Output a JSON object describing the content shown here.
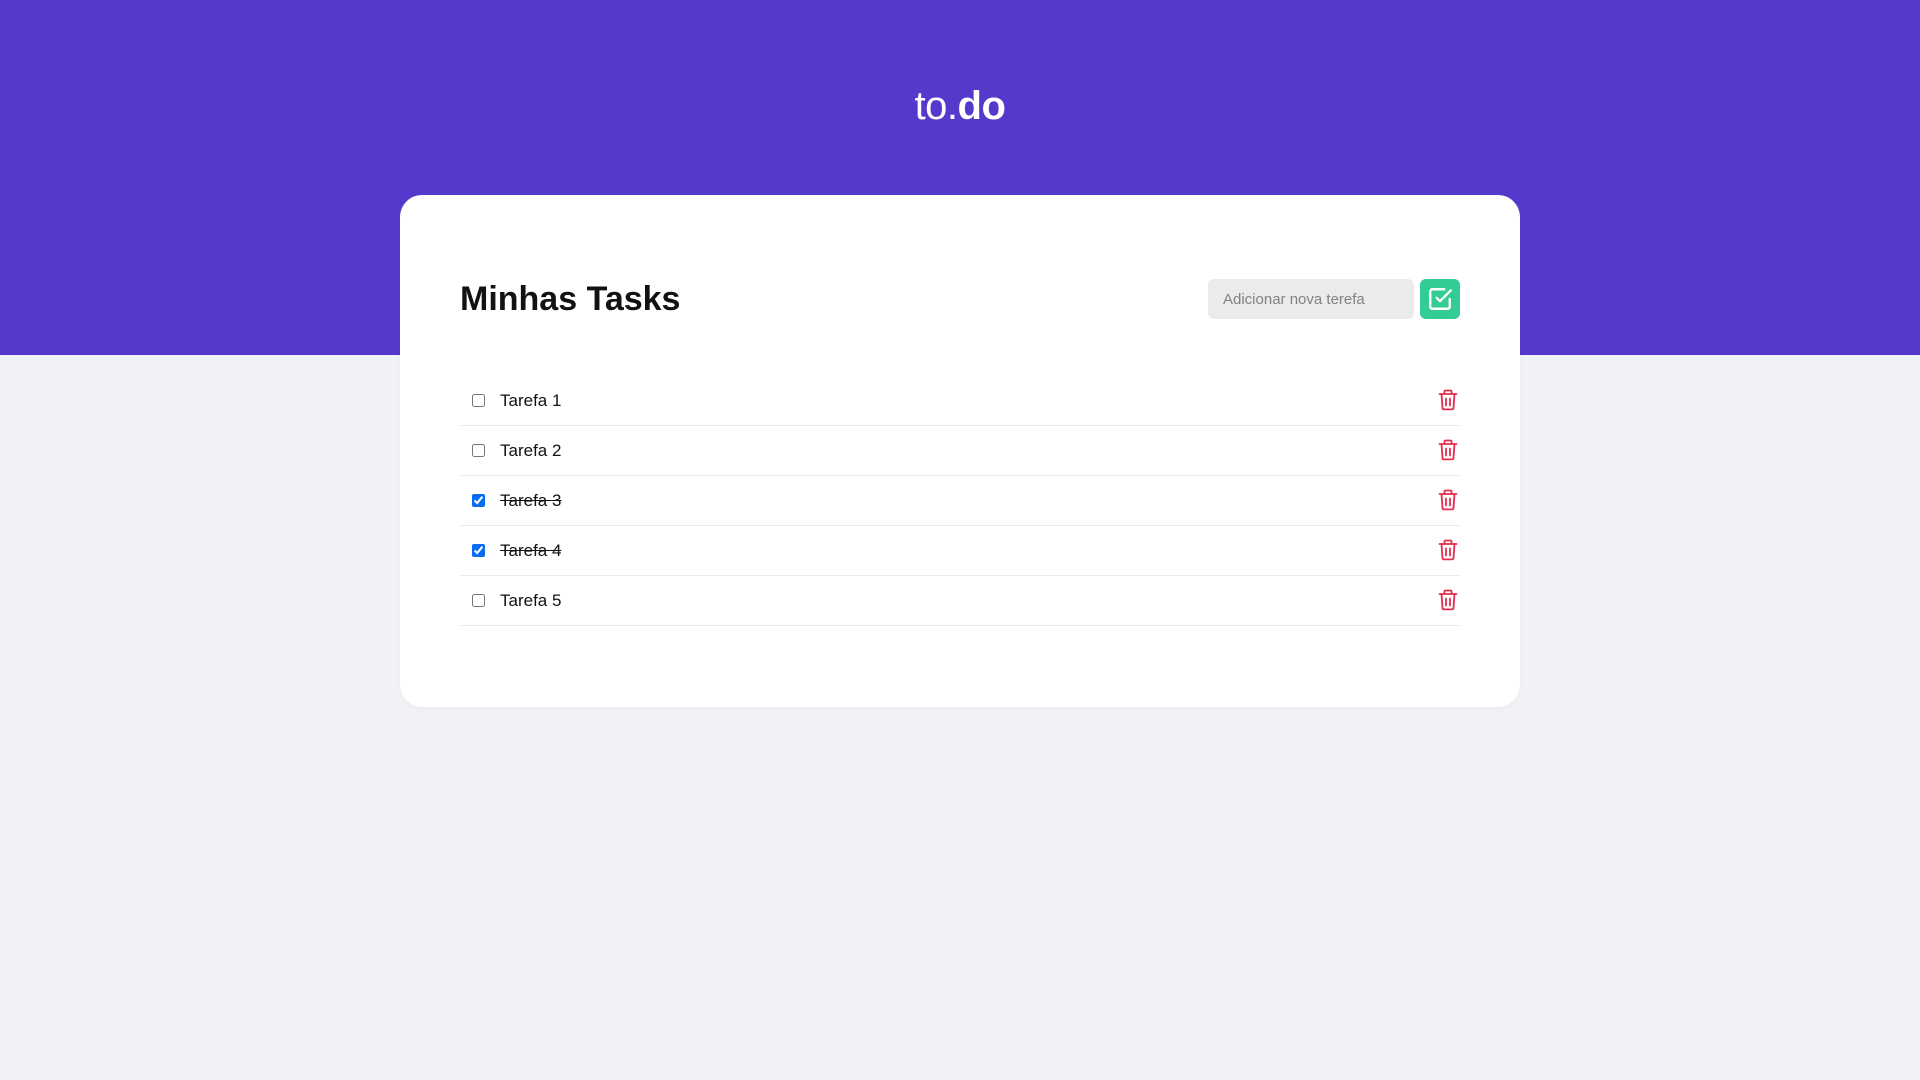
{
  "header": {
    "logo_light": "to.",
    "logo_bold": "do"
  },
  "main": {
    "title": "Minhas Tasks",
    "add_input": {
      "value": "",
      "placeholder": "Adicionar nova terefa"
    },
    "add_button_icon": "check-square-icon",
    "delete_icon": "trash-icon",
    "tasks": [
      {
        "label": "Tarefa 1",
        "completed": false
      },
      {
        "label": "Tarefa 2",
        "completed": false
      },
      {
        "label": "Tarefa 3",
        "completed": true
      },
      {
        "label": "Tarefa 4",
        "completed": true
      },
      {
        "label": "Tarefa 5",
        "completed": false
      }
    ]
  },
  "colors": {
    "header_bg": "#5539cc",
    "page_bg": "#f0f2f5",
    "add_button": "#33cc95",
    "delete_icon": "#e52e4d",
    "checkbox_checked": "#0a6cf0"
  }
}
